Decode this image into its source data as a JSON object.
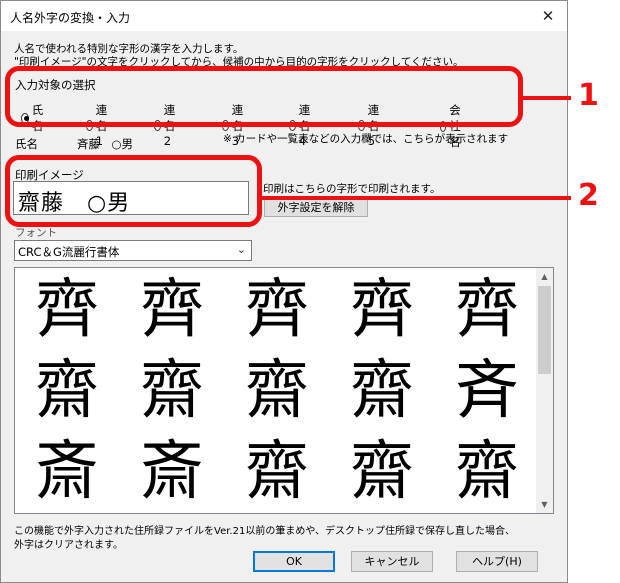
{
  "window": {
    "title": "人名外字の変換・入力",
    "close_glyph": "✕"
  },
  "description": {
    "line1": "人名で使われる特別な字形の漢字を入力します。",
    "line2": "\"印刷イメージ\"の文字をクリックしてから、候補の中から目的の字形をクリックしてください。"
  },
  "target_group": {
    "label": "入力対象の選択",
    "options": [
      "氏名",
      "連名1",
      "連名2",
      "連名3",
      "連名4",
      "連名5",
      "会社名"
    ],
    "selected": "氏名"
  },
  "name_row": {
    "label": "氏名",
    "value": "斉藤　○男",
    "note": "※ カードや一覧表などの入力欄では、こちらが表示されます"
  },
  "print_image": {
    "label": "印刷イメージ",
    "value": "齋藤　○男",
    "note": "印刷はこちらの字形で印刷されます。",
    "clear_button": "外字設定を解除"
  },
  "font_group": {
    "label": "フォント",
    "selected": "CRC＆G流麗行書体"
  },
  "candidates": [
    "齊",
    "齊",
    "齊",
    "齊",
    "齊",
    "齋",
    "齋",
    "齋",
    "齋",
    "斉",
    "斎",
    "斎",
    "齋",
    "齋",
    "齋"
  ],
  "footer": {
    "line1": "この機能で外字入力された住所録ファイルをVer.21以前の筆まめや、デスクトップ住所録で保存し直した場合、",
    "line2": "外字はクリアされます。"
  },
  "buttons": {
    "ok": "OK",
    "cancel": "キャンセル",
    "help": "ヘルプ(H)"
  },
  "callouts": {
    "one": "1",
    "two": "2",
    "color": "#ee1111"
  }
}
